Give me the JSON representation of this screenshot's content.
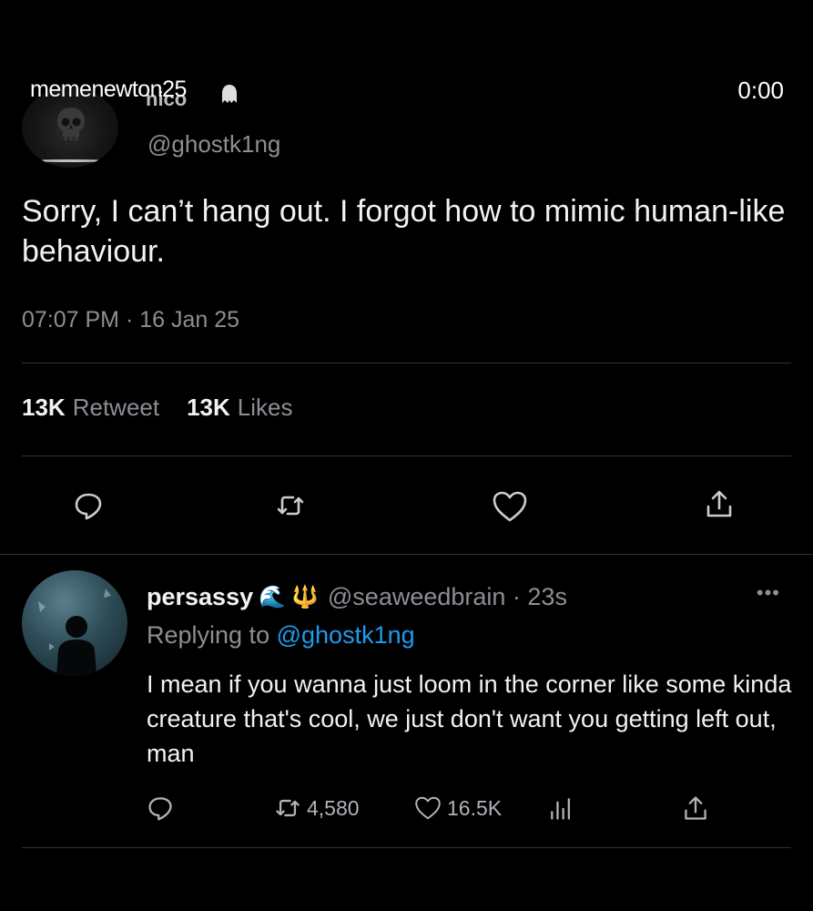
{
  "overlay": {
    "username": "memenewton25",
    "timestamp": "0:00"
  },
  "tweet": {
    "display_name_partial": "nico",
    "handle": "@ghostk1ng",
    "text": "Sorry, I can’t hang out. I forgot how to mimic human-like behaviour.",
    "time": "07:07 PM · 16 Jan 25",
    "retweets_count": "13K",
    "retweets_label": "Retweet",
    "likes_count": "13K",
    "likes_label": "Likes",
    "actions": [
      "reply-icon",
      "retweet-icon",
      "heart-icon",
      "share-icon"
    ]
  },
  "reply": {
    "name": "persassy",
    "emoji": [
      "🌊",
      "🔱"
    ],
    "handle_time": "@seaweedbrain · 23s",
    "more": "•••",
    "replying_prefix": "Replying to",
    "replying_to": "@ghostk1ng",
    "text": "I mean if you wanna just loom in the corner like some kinda creature that's cool, we just don't want you getting left out, man",
    "retweets": "4,580",
    "likes": "16.5K"
  },
  "colors": {
    "background": "#000000",
    "text": "#e7e9ea",
    "muted": "#8b8f94",
    "link": "#1d9bf0",
    "divider": "#2f3336"
  }
}
